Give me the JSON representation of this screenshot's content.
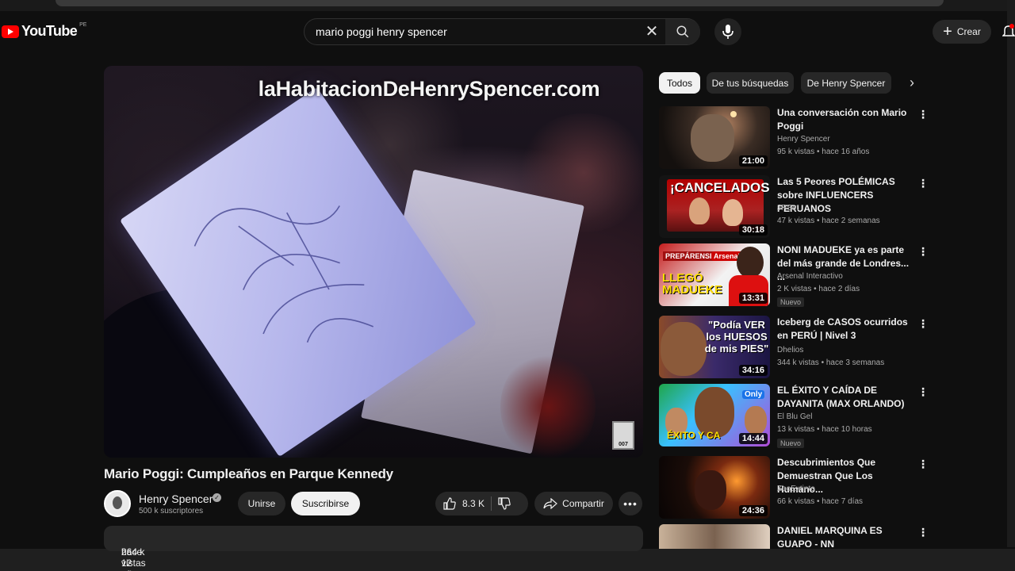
{
  "app": {
    "logo_text": "YouTube",
    "country_code": "PE"
  },
  "search": {
    "query": "mario poggi henry spencer"
  },
  "header": {
    "create_label": "Crear"
  },
  "player": {
    "watermark": "laHabitacionDeHenrySpencer.com",
    "badge_text": "007"
  },
  "video": {
    "title": "Mario Poggi: Cumpleaños en Parque Kennedy",
    "channel": "Henry Spencer",
    "subscribers": "500 k suscriptores",
    "join_label": "Unirse",
    "subscribe_label": "Suscribirse",
    "likes": "8.3 K",
    "share_label": "Compartir",
    "views": "264 k vistas",
    "age": "hace 12 años"
  },
  "chips": [
    {
      "label": "Todos"
    },
    {
      "label": "De tus búsquedas"
    },
    {
      "label": "De Henry Spencer"
    }
  ],
  "recommendations": [
    {
      "title": "Una conversación con Mario Poggi",
      "channel": "Henry Spencer",
      "stats": "95 k vistas • hace 16 años",
      "duration": "21:00"
    },
    {
      "title": "Las 5 Peores POLÉMICAS sobre INFLUENCERS PERUANOS",
      "channel": "JRSet",
      "stats": "47 k vistas • hace 2 semanas",
      "duration": "30:18",
      "thumb_text": "¡CANCELADOS!"
    },
    {
      "title": "NONI MADUEKE ya es parte del más grande de Londres... ...",
      "channel": "Arsenal Interactivo",
      "stats": "2 K vistas • hace 2 días",
      "duration": "13:31",
      "new": "Nuevo",
      "thumb_text": "LLEGÓ MADUEKE",
      "thumb_text2": "PREPÁRENSE...",
      "thumb_text3": "Arsenal"
    },
    {
      "title": "Iceberg de CASOS ocurridos en PERÚ | Nivel 3",
      "channel": "Dhelios",
      "stats": "344 k vistas • hace 3 semanas",
      "duration": "34:16",
      "thumb_text": "\"Podía VER los HUESOS de mis PIES\""
    },
    {
      "title": "EL ÉXITO Y CAÍDA DE DAYANITA (MAX ORLANDO)",
      "channel": "El Blu Gel",
      "stats": "13 k vistas • hace 10 horas",
      "duration": "14:44",
      "new": "Nuevo",
      "thumb_text": "ÉXITO Y CA",
      "thumb_text2": "Only"
    },
    {
      "title": "Descubrimientos Que Demuestran Que Los Humano...",
      "channel": "ZooExtinto",
      "stats": "66 k vistas • hace 7 días",
      "duration": "24:36"
    },
    {
      "title": "DANIEL MARQUINA ES GUAPO - NN",
      "channel": "",
      "stats": "",
      "duration": ""
    }
  ]
}
